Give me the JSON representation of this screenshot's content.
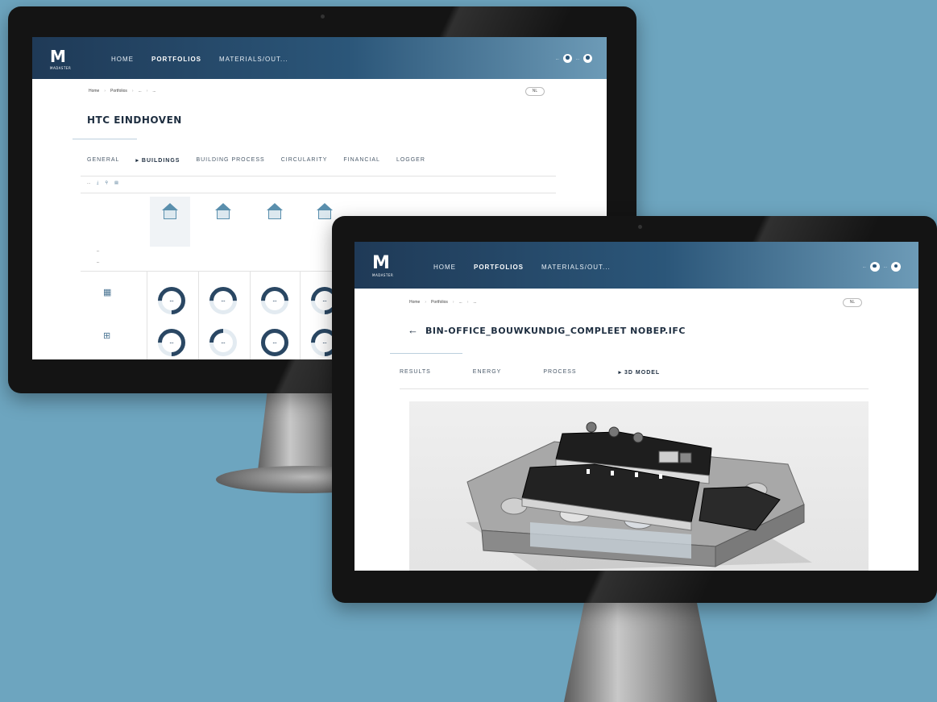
{
  "monitor_back": {
    "header": {
      "logo": "M",
      "logo_sub": "MADASTER",
      "nav": [
        "HOME",
        "PORTFOLIOS",
        "MATERIALS/OUT..."
      ],
      "right_text_1": "...",
      "right_text_2": "..."
    },
    "breadcrumbs": [
      "Home",
      "Portfolios",
      "...",
      "..."
    ],
    "lang": "NL",
    "title": "HTC EINDHOVEN",
    "tabs": [
      "GENERAL",
      "▸ BUILDINGS",
      "BUILDING PROCESS",
      "CIRCULARITY",
      "FINANCIAL",
      "LOGGER"
    ],
    "active_tab": 1,
    "filter_text": "...",
    "building_labels": [
      "",
      "",
      "",
      "",
      "",
      "",
      "",
      ""
    ],
    "row_labels": [
      "...",
      "..."
    ],
    "gauges": [
      {
        "value": "...",
        "pct": 0.7,
        "color": "#2a4763"
      },
      {
        "value": "...",
        "pct": 0.45,
        "color": "#2a4763"
      },
      {
        "value": "...",
        "pct": 0.35,
        "color": "#2a4763"
      },
      {
        "value": "...",
        "pct": 0.55,
        "color": "#2a4763"
      },
      {
        "value": "...",
        "pct": 0.6,
        "color": "#2a4763"
      },
      {
        "value": "...",
        "pct": 0.1,
        "color": "#2a4763"
      },
      {
        "value": "...",
        "pct": 0.8,
        "color": "#2a4763"
      },
      {
        "value": "...",
        "pct": 0.65,
        "color": "#2a4763"
      }
    ]
  },
  "monitor_front": {
    "header": {
      "logo": "M",
      "logo_sub": "MADASTER",
      "nav": [
        "HOME",
        "PORTFOLIOS",
        "MATERIALS/OUT..."
      ],
      "right_text_1": "...",
      "right_text_2": "..."
    },
    "breadcrumbs": [
      "Home",
      "Portfolios",
      "...",
      "..."
    ],
    "lang": "NL",
    "back_arrow": "←",
    "title": "BIN-OFFICE_BOUWKUNDIG_COMPLEET NOBEP.IFC",
    "tabs": [
      "RESULTS",
      "ENERGY",
      "PROCESS",
      "▸ 3D MODEL"
    ],
    "active_tab": 3
  }
}
